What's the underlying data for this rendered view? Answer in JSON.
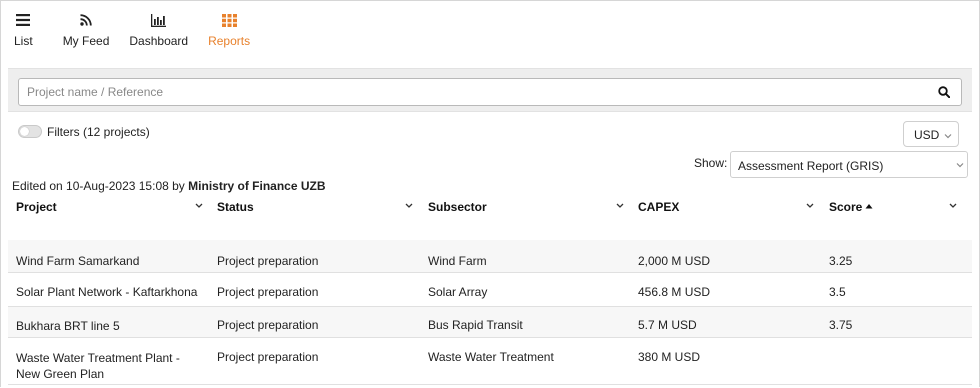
{
  "nav": {
    "items": [
      {
        "label": "List",
        "icon": "list-icon"
      },
      {
        "label": "My Feed",
        "icon": "rss-feed-icon"
      },
      {
        "label": "Dashboard",
        "icon": "bar-chart-icon"
      },
      {
        "label": "Reports",
        "icon": "grid-icon",
        "active": true
      }
    ],
    "active_color": "#e8812c"
  },
  "search": {
    "placeholder": "Project name / Reference",
    "value": ""
  },
  "filters": {
    "label": "Filters (12 projects)",
    "enabled": false
  },
  "currency": {
    "selected": "USD"
  },
  "show": {
    "label": "Show:",
    "selected": "Assessment Report (GRIS)"
  },
  "edited": {
    "prefix": "Edited on 10-Aug-2023 15:08 by",
    "author": "Ministry of Finance UZB"
  },
  "table": {
    "columns": [
      "Project",
      "Status",
      "Subsector",
      "CAPEX",
      "Score"
    ],
    "sort_column": "Score",
    "sort_direction": "asc",
    "rows": [
      [
        "Wind Farm Samarkand",
        "Project preparation",
        "Wind Farm",
        "2,000 M USD",
        "3.25"
      ],
      [
        "Solar Plant Network - Kaftarkhona",
        "Project preparation",
        "Solar Array",
        "456.8 M USD",
        "3.5"
      ],
      [
        "Bukhara BRT line 5",
        "Project preparation",
        "Bus Rapid Transit",
        "5.7 M USD",
        "3.75"
      ],
      [
        "Waste Water Treatment Plant - New Green Plan",
        "Project preparation",
        "Waste Water Treatment",
        "380 M USD",
        ""
      ]
    ]
  }
}
